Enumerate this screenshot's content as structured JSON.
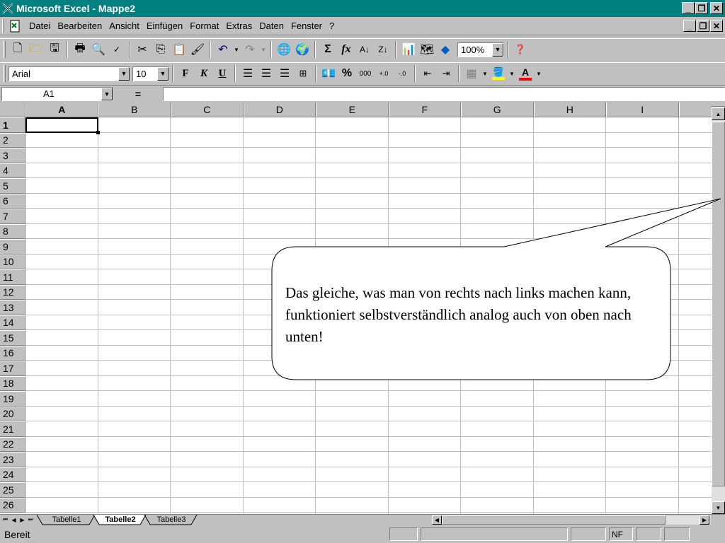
{
  "window": {
    "title": "Microsoft Excel - Mappe2"
  },
  "menu": {
    "items": [
      "Datei",
      "Bearbeiten",
      "Ansicht",
      "Einfügen",
      "Format",
      "Extras",
      "Daten",
      "Fenster",
      "?"
    ]
  },
  "standard_toolbar": {
    "zoom": "100%"
  },
  "format_toolbar": {
    "font_name": "Arial",
    "font_size": "10",
    "bold_label": "F",
    "italic_label": "K",
    "underline_label": "U",
    "percent_label": "%",
    "thousands_label": "000"
  },
  "formula_bar": {
    "cell_ref": "A1",
    "equals_label": "="
  },
  "grid": {
    "columns": [
      "A",
      "B",
      "C",
      "D",
      "E",
      "F",
      "G",
      "H",
      "I"
    ],
    "rows": [
      "1",
      "2",
      "3",
      "4",
      "5",
      "6",
      "7",
      "8",
      "9",
      "10",
      "11",
      "12",
      "13",
      "14",
      "15",
      "16",
      "17",
      "18",
      "19",
      "20",
      "21",
      "22",
      "23",
      "24",
      "25",
      "26"
    ],
    "active_cell": "A1"
  },
  "sheet_tabs": [
    "Tabelle1",
    "Tabelle2",
    "Tabelle3"
  ],
  "active_sheet": "Tabelle2",
  "status": {
    "text": "Bereit",
    "nf": "NF"
  },
  "callout": {
    "text": "Das gleiche, was man von rechts nach links machen kann, funktioniert selbstverständlich analog auch von oben nach unten!"
  },
  "colors": {
    "title_bar": "#008080",
    "chrome": "#c0c0c0",
    "grid_line": "#c0c0c0"
  }
}
